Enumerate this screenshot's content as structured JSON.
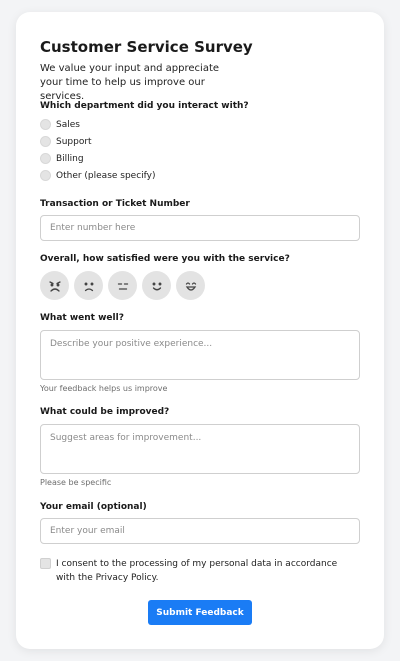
{
  "title": "Customer Service Survey",
  "intro": "We value your input and appreciate your time to help us improve our services.",
  "department": {
    "question": "Which department did you interact with?",
    "options": [
      "Sales",
      "Support",
      "Billing",
      "Other (please specify)"
    ]
  },
  "transaction": {
    "label": "Transaction or Ticket Number",
    "placeholder": "Enter number here"
  },
  "satisfaction": {
    "question": "Overall, how satisfied were you with the service?",
    "icons": [
      "very-dissatisfied-icon",
      "dissatisfied-icon",
      "neutral-icon",
      "satisfied-icon",
      "very-satisfied-icon"
    ]
  },
  "went_well": {
    "label": "What went well?",
    "placeholder": "Describe your positive experience...",
    "hint": "Your feedback helps us improve"
  },
  "improve": {
    "label": "What could be improved?",
    "placeholder": "Suggest areas for improvement...",
    "hint": "Please be specific"
  },
  "email": {
    "label": "Your email (optional)",
    "placeholder": "Enter your email"
  },
  "consent": {
    "text": "I consent to the processing of my personal data in accordance with the Privacy Policy."
  },
  "submit_label": "Submit Feedback",
  "colors": {
    "accent": "#1a7cf5",
    "background": "#f3f4f6",
    "card": "#ffffff"
  }
}
